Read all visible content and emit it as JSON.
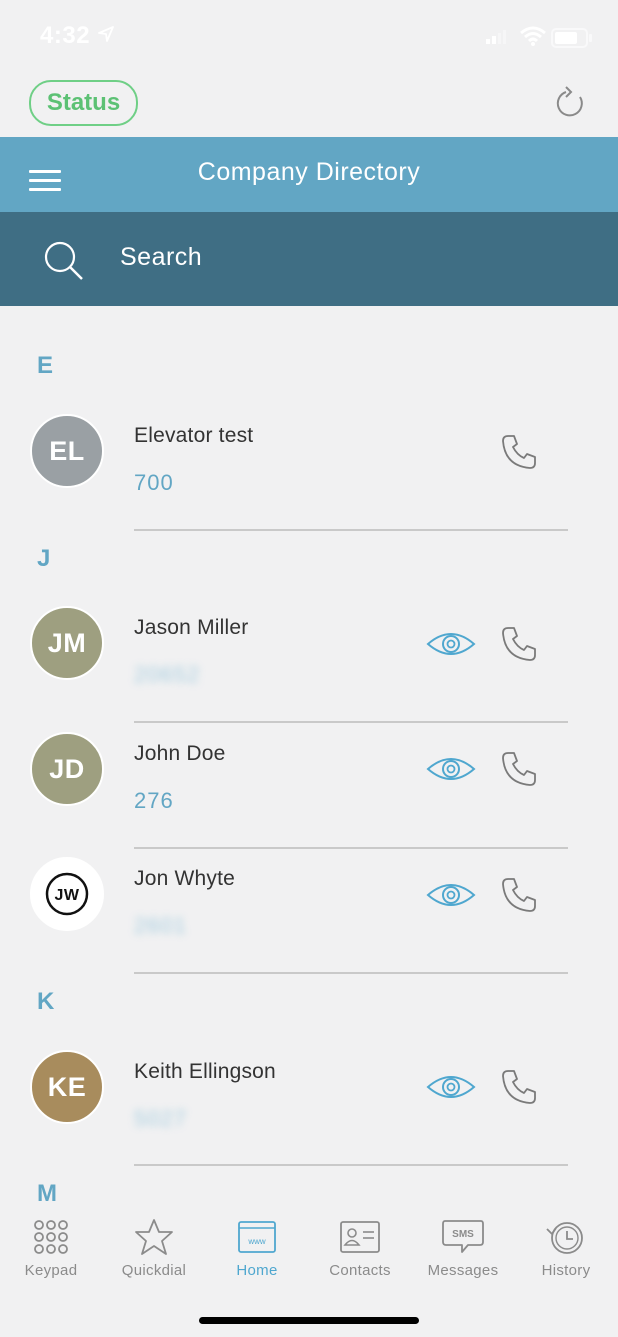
{
  "statusbar": {
    "time": "4:32"
  },
  "header": {
    "status_label": "Status",
    "title": "Company Directory"
  },
  "search": {
    "placeholder": "Search"
  },
  "sections": [
    {
      "letter": "E"
    },
    {
      "letter": "J"
    },
    {
      "letter": "K"
    },
    {
      "letter": "M"
    }
  ],
  "contacts": [
    {
      "initials": "EL",
      "name": "Elevator test",
      "number": "700",
      "avatar_color": "#9aa0a4"
    },
    {
      "initials": "JM",
      "name": "Jason Miller",
      "number": "20652",
      "avatar_color": "#9e9f80"
    },
    {
      "initials": "JD",
      "name": "John Doe",
      "number": "276",
      "avatar_color": "#9e9f80"
    },
    {
      "initials": "JW",
      "name": "Jon Whyte",
      "number": "2601",
      "avatar_color": "#ffffff"
    },
    {
      "initials": "KE",
      "name": "Keith Ellingson",
      "number": "5027",
      "avatar_color": "#a88c5d"
    }
  ],
  "tabs": [
    {
      "label": "Keypad",
      "icon": "keypad-icon"
    },
    {
      "label": "Quickdial",
      "icon": "star-icon"
    },
    {
      "label": "Home",
      "icon": "www-icon",
      "active": true
    },
    {
      "label": "Contacts",
      "icon": "contact-card-icon"
    },
    {
      "label": "Messages",
      "icon": "sms-icon"
    },
    {
      "label": "History",
      "icon": "history-icon"
    }
  ],
  "colors": {
    "accent": "#62a6c4",
    "search_bg": "#3f6e84",
    "status_green": "#5cc174"
  }
}
